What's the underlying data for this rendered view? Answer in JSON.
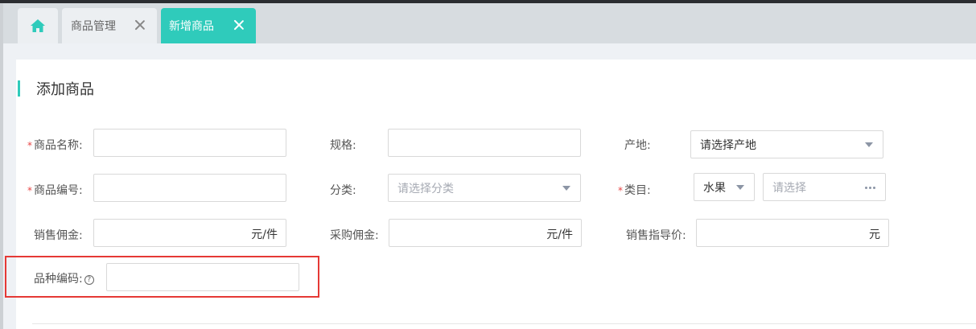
{
  "tabs": [
    {
      "icon": "home-icon"
    },
    {
      "label": "商品管理",
      "active": false
    },
    {
      "label": "新增商品",
      "active": true
    }
  ],
  "colors": {
    "accent": "#2fcbbb",
    "required": "#e84545",
    "highlight": "#e53935"
  },
  "section": {
    "title": "添加商品"
  },
  "form": {
    "name": {
      "label": "商品名称:",
      "required": true,
      "value": ""
    },
    "spec": {
      "label": "规格:",
      "value": ""
    },
    "origin": {
      "label": "产地:",
      "placeholder": "请选择产地"
    },
    "code": {
      "label": "商品编号:",
      "required": true,
      "value": ""
    },
    "category": {
      "label": "分类:",
      "placeholder": "请选择分类"
    },
    "catalog": {
      "label": "类目:",
      "required": true,
      "value": "水果",
      "sub_placeholder": "请选择"
    },
    "sales_commission": {
      "label": "销售佣金:",
      "value": "",
      "unit": "元/件"
    },
    "purchase_commission": {
      "label": "采购佣金:",
      "value": "",
      "unit": "元/件"
    },
    "guide_price": {
      "label": "销售指导价:",
      "value": "",
      "unit": "元"
    },
    "variety_code": {
      "label": "品种编码:",
      "help": "?",
      "value": ""
    }
  }
}
